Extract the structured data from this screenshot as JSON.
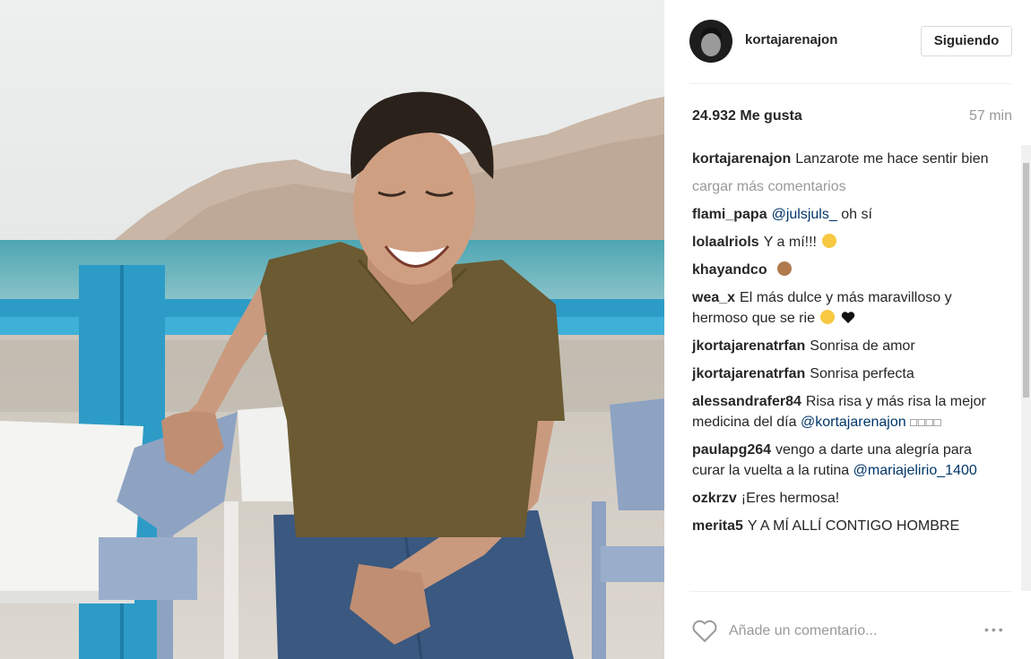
{
  "post": {
    "username": "kortajarenajon",
    "follow_label": "Siguiendo",
    "likes": "24.932 Me gusta",
    "time": "57 min",
    "load_more": "cargar más comentarios",
    "add_comment_placeholder": "Añade un comentario...",
    "more_options": "•••"
  },
  "caption": {
    "user": "kortajarenajon",
    "text": "Lanzarote me hace sentir bien"
  },
  "comments": [
    {
      "user": "flami_papa",
      "mention": "@julsjuls_",
      "text": " oh sí"
    },
    {
      "user": "lolaalriols",
      "text": "Y a mí!!!",
      "emoji": "astonished-emoji"
    },
    {
      "user": "khayandco",
      "text": "",
      "emoji": "see-no-evil-monkey-emoji"
    },
    {
      "user": "wea_x",
      "text": "El más dulce y más maravilloso y hermoso que se rie",
      "emoji": "heart-eyes-emoji",
      "emoji2": "black-heart-emoji"
    },
    {
      "user": "jkortajarenatrfan",
      "text": "Sonrisa de amor"
    },
    {
      "user": "jkortajarenatrfan",
      "text": "Sonrisa perfecta"
    },
    {
      "user": "alessandrafer84",
      "text": "Risa risa y más risa la mejor medicina del día",
      "mention": "@kortajarenajon",
      "tail": "□□□□"
    },
    {
      "user": "paulapg264",
      "text": "vengo a darte una alegría para curar la vuelta a la rutina",
      "mention": "@mariajelirio_1400"
    },
    {
      "user": "ozkrzv",
      "text": "¡Eres hermosa!"
    },
    {
      "user": "merita5",
      "text": "Y A MÍ ALLÍ CONTIGO HOMBRE"
    }
  ],
  "icons": {
    "like": "heart-outline-icon",
    "more": "more-options-icon"
  },
  "colors": {
    "mention": "#003569",
    "muted": "#999999",
    "sea": "#4aaab8",
    "railing": "#2c9cc7"
  }
}
